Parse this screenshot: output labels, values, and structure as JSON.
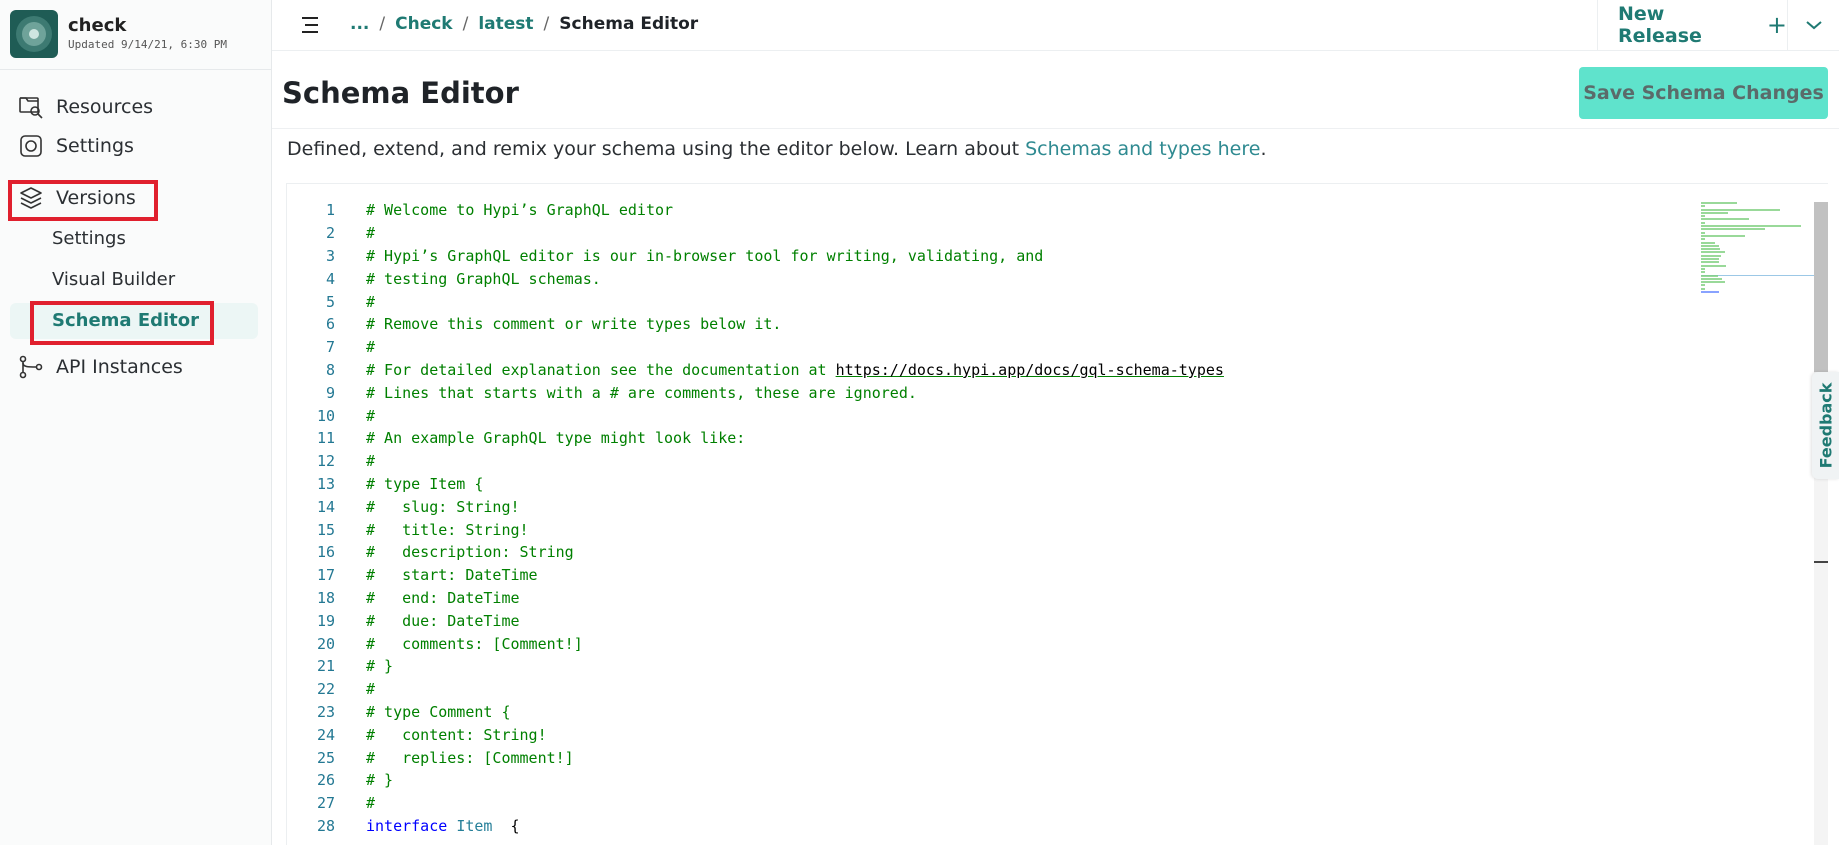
{
  "project": {
    "name": "check",
    "updated": "Updated 9/14/21, 6:30 PM"
  },
  "sidebar": {
    "items": [
      {
        "label": "Resources",
        "icon": "resources-icon"
      },
      {
        "label": "Settings",
        "icon": "settings-icon"
      },
      {
        "label": "Versions",
        "icon": "layers-icon"
      },
      {
        "label": "API Instances",
        "icon": "branch-icon"
      }
    ],
    "subitems": [
      {
        "label": "Settings"
      },
      {
        "label": "Visual Builder"
      },
      {
        "label": "Schema Editor",
        "active": true
      }
    ]
  },
  "breadcrumb": {
    "ellipsis": "...",
    "items": [
      "Check",
      "latest"
    ],
    "current": "Schema Editor",
    "separator": "/"
  },
  "topbar": {
    "new_release_label": "New Release",
    "plus": "+"
  },
  "page": {
    "title": "Schema Editor",
    "save_label": "Save Schema Changes",
    "description_prefix": "Defined, extend, and remix your schema using the editor below. Learn about ",
    "description_link": "Schemas and types here",
    "description_suffix": "."
  },
  "editor": {
    "lines": [
      {
        "n": "1",
        "text": "# Welcome to Hypi’s GraphQL editor"
      },
      {
        "n": "2",
        "text": "#"
      },
      {
        "n": "3",
        "text": "# Hypi’s GraphQL editor is our in-browser tool for writing, validating, and"
      },
      {
        "n": "4",
        "text": "# testing GraphQL schemas."
      },
      {
        "n": "5",
        "text": "#"
      },
      {
        "n": "6",
        "text": "# Remove this comment or write types below it."
      },
      {
        "n": "7",
        "text": "#"
      },
      {
        "n": "8",
        "text": "# For detailed explanation see the documentation at ",
        "url": "https://docs.hypi.app/docs/gql-schema-types"
      },
      {
        "n": "9",
        "text": "# Lines that starts with a # are comments, these are ignored."
      },
      {
        "n": "10",
        "text": "#"
      },
      {
        "n": "11",
        "text": "# An example GraphQL type might look like:"
      },
      {
        "n": "12",
        "text": "#"
      },
      {
        "n": "13",
        "text": "# type Item {"
      },
      {
        "n": "14",
        "text": "#   slug: String!"
      },
      {
        "n": "15",
        "text": "#   title: String!"
      },
      {
        "n": "16",
        "text": "#   description: String"
      },
      {
        "n": "17",
        "text": "#   start: DateTime"
      },
      {
        "n": "18",
        "text": "#   end: DateTime"
      },
      {
        "n": "19",
        "text": "#   due: DateTime"
      },
      {
        "n": "20",
        "text": "#   comments: [Comment!]"
      },
      {
        "n": "21",
        "text": "# }"
      },
      {
        "n": "22",
        "text": "#"
      },
      {
        "n": "23",
        "text": "# type Comment {"
      },
      {
        "n": "24",
        "text": "#   content: String!"
      },
      {
        "n": "25",
        "text": "#   replies: [Comment!]"
      },
      {
        "n": "26",
        "text": "# }"
      },
      {
        "n": "27",
        "text": "#"
      },
      {
        "n": "28",
        "keyword": "interface",
        "type": "Item",
        "rest": "  {"
      }
    ]
  },
  "feedback_label": "Feedback",
  "colors": {
    "accent": "#1f7a73",
    "save_button": "#5fe3cc",
    "highlight": "#e0202e",
    "comment": "#008000"
  }
}
